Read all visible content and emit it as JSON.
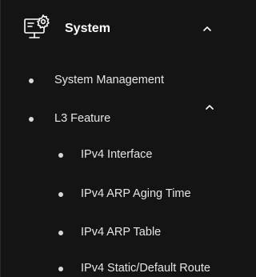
{
  "menu": {
    "header": {
      "label": "System",
      "icon": "system-settings-icon",
      "expanded": true
    },
    "items": [
      {
        "label": "System Management"
      },
      {
        "label": "L3 Feature",
        "expanded": true,
        "children": [
          {
            "label": "IPv4 Interface"
          },
          {
            "label": "IPv4 ARP Aging Time"
          },
          {
            "label": "IPv4 ARP Table"
          },
          {
            "label": "IPv4 Static/Default Route"
          }
        ]
      }
    ]
  },
  "colors": {
    "background": "#141414",
    "text": "#e6e6e6",
    "header_text": "#ffffff"
  }
}
